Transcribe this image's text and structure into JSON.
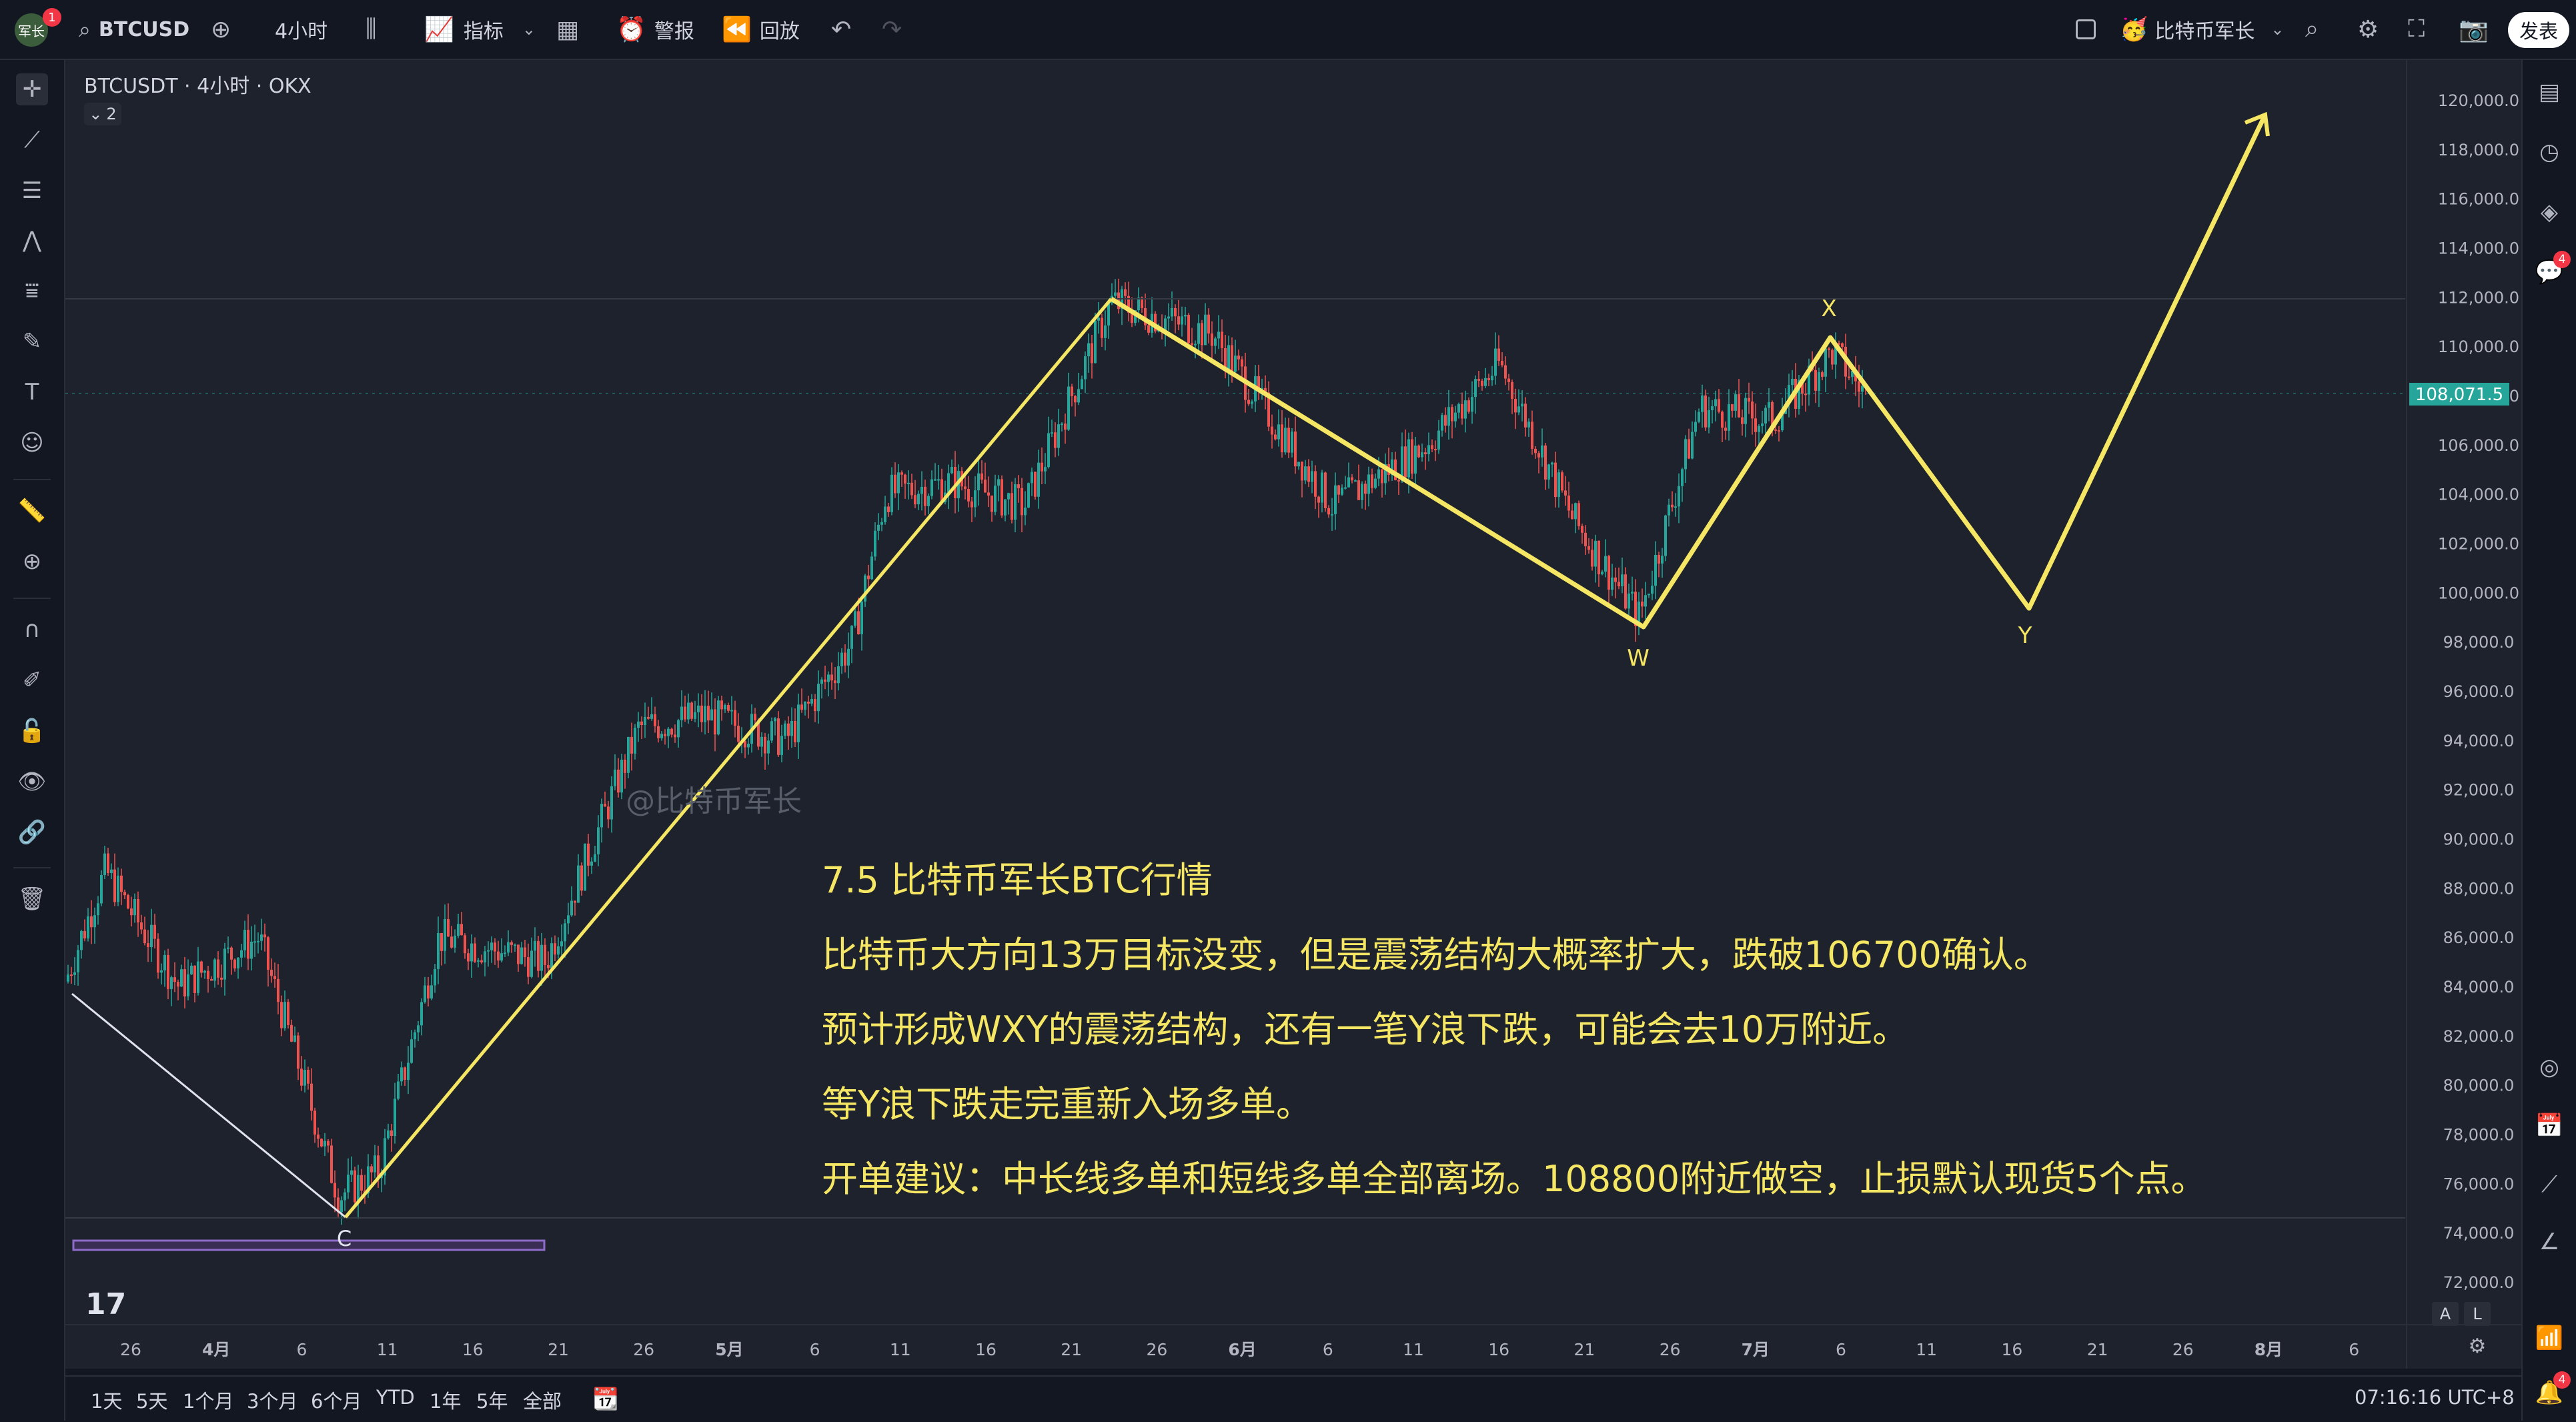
{
  "topbar": {
    "avatar_text": "军长",
    "avatar_badge": "1",
    "symbol": "BTCUSD",
    "interval": "4小时",
    "indicators_label": "指标",
    "alert_label": "警报",
    "replay_label": "回放",
    "account_name": "比特币军长",
    "publish_label": "发表"
  },
  "chart": {
    "legend_title": "BTCUSDT · 4小时 · OKX",
    "legend_collapse_count": "2",
    "watermark": "@比特币军长",
    "current_price": "108,071.5",
    "price_ticks": [
      "120,000.0",
      "118,000.0",
      "116,000.0",
      "114,000.0",
      "112,000.0",
      "110,000.0",
      "108,000.0",
      "106,000.0",
      "104,000.0",
      "102,000.0",
      "100,000.0",
      "98,000.0",
      "96,000.0",
      "94,000.0",
      "92,000.0",
      "90,000.0",
      "88,000.0",
      "86,000.0",
      "84,000.0",
      "82,000.0",
      "80,000.0",
      "78,000.0",
      "76,000.0",
      "74,000.0",
      "72,000.0"
    ],
    "time_ticks": [
      "26",
      "4月",
      "6",
      "11",
      "16",
      "21",
      "26",
      "5月",
      "6",
      "11",
      "16",
      "21",
      "26",
      "6月",
      "6",
      "11",
      "16",
      "21",
      "26",
      "7月",
      "6",
      "11",
      "16",
      "21",
      "26",
      "8月",
      "6"
    ],
    "wave_labels": {
      "c": "C",
      "w": "W",
      "x": "X",
      "y": "Y"
    },
    "annotation": {
      "title": "7.5 比特币军长BTC行情",
      "line1": "比特币大方向13万目标没变，但是震荡结构大概率扩大，跌破106700确认。",
      "line2": "预计形成WXY的震荡结构，还有一笔Y浪下跌，可能会去10万附近。",
      "line3": "等Y浪下跌走完重新入场多单。",
      "line4": "开单建议：中长线多单和短线多单全部离场。108800附近做空，止损默认现货5个点。"
    },
    "scale_a": "A",
    "scale_l": "L",
    "colors": {
      "up": "#26a69a",
      "down": "#ef5350",
      "annotation": "#f5e663",
      "price_badge": "#26a69a"
    }
  },
  "bottombar": {
    "ranges": [
      "1天",
      "5天",
      "1个月",
      "3个月",
      "6个月",
      "YTD",
      "1年",
      "5年",
      "全部"
    ],
    "clock": "07:16:16 UTC+8"
  },
  "rightbar": {
    "chat_badge": "4",
    "notify_badge": "4"
  }
}
